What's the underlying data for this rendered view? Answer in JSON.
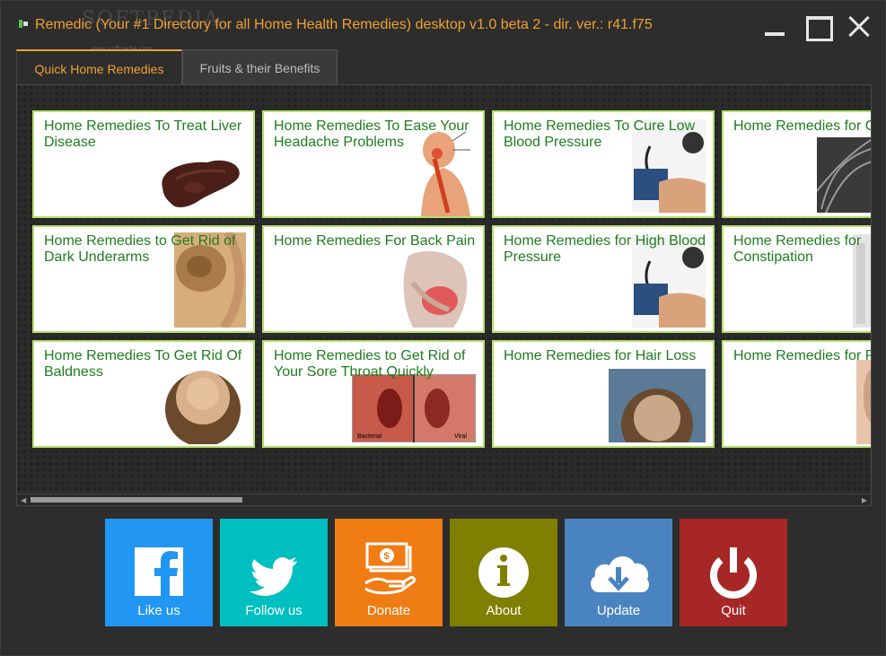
{
  "window": {
    "title": "Remedic (Your #1 Directory for all Home Health Remedies) desktop v1.0 beta 2 - dir. ver.: r41.f75",
    "watermark": "SOFTPEDIA",
    "watermark_sub": "www.softpedia.com"
  },
  "tabs": [
    {
      "label": "Quick Home Remedies",
      "active": true
    },
    {
      "label": "Fruits & their Benefits",
      "active": false
    }
  ],
  "cards": [
    {
      "title": "Home Remedies To Treat Liver Disease",
      "image": "liver-image"
    },
    {
      "title": "Home Remedies To Ease Your Headache Problems",
      "image": "headache-image"
    },
    {
      "title": "Home Remedies To Cure Low Blood Pressure",
      "image": "blood-pressure-image"
    },
    {
      "title": "Home Remedies for G",
      "image": "hair-image"
    },
    {
      "title": "Home Remedies to Get Rid of Dark Underarms",
      "image": "underarm-image"
    },
    {
      "title": "Home Remedies For Back Pain",
      "image": "back-pain-image"
    },
    {
      "title": "Home Remedies for High Blood Pressure",
      "image": "blood-pressure-image"
    },
    {
      "title": "Home Remedies for Constipation",
      "image": "constipation-image"
    },
    {
      "title": "Home Remedies To Get Rid Of Baldness",
      "image": "baldness-image"
    },
    {
      "title": "Home Remedies to Get Rid of Your Sore Throat Quickly",
      "image": "throat-image"
    },
    {
      "title": "Home Remedies for Hair Loss",
      "image": "hair-loss-image"
    },
    {
      "title": "Home Remedies for P",
      "image": "face-image"
    }
  ],
  "throat_labels": {
    "left": "Bacterial",
    "right": "Viral"
  },
  "actions": [
    {
      "label": "Like us",
      "icon": "facebook-icon",
      "color": "#2196f3"
    },
    {
      "label": "Follow us",
      "icon": "twitter-icon",
      "color": "#00bfc0"
    },
    {
      "label": "Donate",
      "icon": "donate-icon",
      "color": "#f07c14"
    },
    {
      "label": "About",
      "icon": "info-icon",
      "color": "#7f7f00"
    },
    {
      "label": "Update",
      "icon": "cloud-download-icon",
      "color": "#4a84c0"
    },
    {
      "label": "Quit",
      "icon": "power-icon",
      "color": "#a72626"
    }
  ],
  "colors": {
    "accent": "#f0a030",
    "card_border": "#b4e06a",
    "card_text": "#1e7d1e"
  }
}
